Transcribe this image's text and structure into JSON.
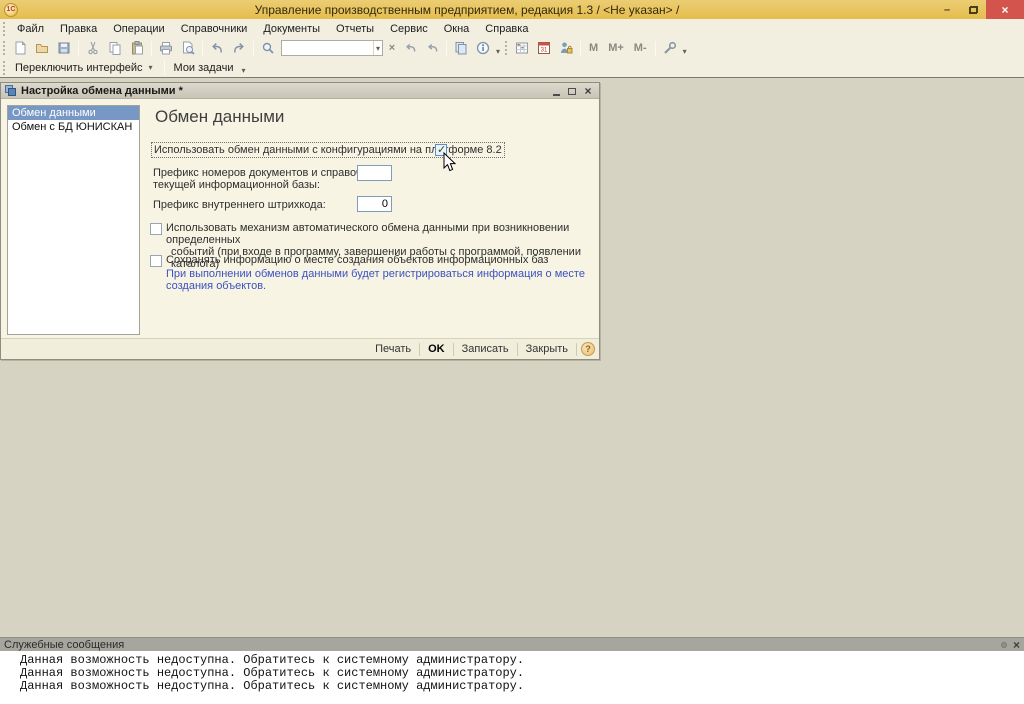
{
  "glyphs": {
    "minimize": "–",
    "close": "×",
    "dropdown": "▾",
    "clear": "×",
    "help": "?"
  },
  "window": {
    "app_icon_text": "1С",
    "title": "Управление производственным предприятием, редакция 1.3 / <Не указан> /"
  },
  "menu": {
    "items": [
      "Файл",
      "Правка",
      "Операции",
      "Справочники",
      "Документы",
      "Отчеты",
      "Сервис",
      "Окна",
      "Справка"
    ]
  },
  "toolbar": {
    "search_value": "",
    "calendar_day": "31",
    "memory": {
      "m": "M",
      "m_plus": "M+",
      "m_minus": "M-"
    }
  },
  "interface_bar": {
    "switch_interface": "Переключить интерфейс",
    "my_tasks": "Мои задачи"
  },
  "dialog": {
    "title": "Настройка обмена данными *",
    "nav": [
      {
        "label": "Обмен данными",
        "selected": true
      },
      {
        "label": "Обмен с БД ЮНИСКАН",
        "selected": false
      }
    ],
    "heading": "Обмен данными",
    "use_exchange": {
      "label": "Использовать обмен данными с конфигурациями на платформе 8.2",
      "checked": true
    },
    "prefix_docs": {
      "label_line1": "Префикс номеров документов и справочников",
      "label_line2": "текущей информационной базы:",
      "value": ""
    },
    "prefix_barcode": {
      "label": "Префикс внутреннего штрихкода:",
      "value": "0"
    },
    "auto_exchange": {
      "label_line1": "Использовать механизм автоматического обмена данными при возникновении определенных",
      "label_line2": "событий (при входе в программу, завершении работы с программой, появлении каталога)",
      "checked": false
    },
    "save_location": {
      "label": "Сохранять информацию о месте создания объектов информационных баз",
      "checked": false,
      "hint": "При выполнении обменов данными будет регистрироваться информация о месте создания объектов."
    },
    "buttons": {
      "print": "Печать",
      "ok": "OK",
      "save": "Записать",
      "close": "Закрыть"
    }
  },
  "messages": {
    "title": "Служебные сообщения",
    "lines": [
      "Данная возможность недоступна. Обратитесь к системному администратору.",
      "Данная возможность недоступна. Обратитесь к системному администратору.",
      "Данная возможность недоступна. Обратитесь к системному администратору."
    ]
  },
  "colors": {
    "titlebar": "#e8c35a",
    "close_button": "#d2544d",
    "panel_bg": "#f2efe0",
    "workspace_bg": "#d6d3c2",
    "selection": "#7797c5",
    "hint_text": "#3a52c4",
    "dialog_bg": "#f7f4e3",
    "messages_header": "#a6a59e"
  }
}
